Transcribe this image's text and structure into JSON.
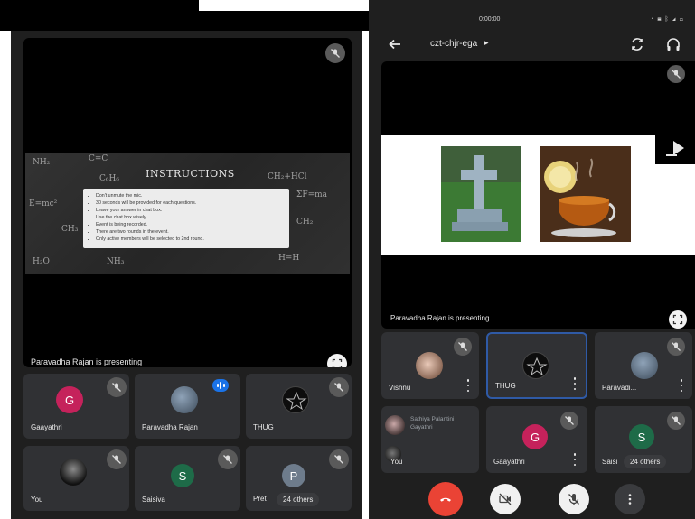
{
  "window": {
    "status_time": "0:00:00",
    "status_icons": "◔ ▦ ᛒ ◢ ▭"
  },
  "left": {
    "presentation": {
      "title": "INSTRUCTIONS",
      "instructions": [
        "Don't unmute the mic.",
        "30 seconds will be provided for each questions.",
        "Leave your answer in chat box.",
        "Use the chat box wisely.",
        "Event is being recorded.",
        "There are two rounds in the event.",
        "Only active members will be selected to 2nd round."
      ],
      "chem": [
        "NH₂",
        "C=C",
        "CH₂+HCl",
        "E=mc²",
        "CH₂",
        "C₆H₆",
        "ΣF=ma",
        "CH₃",
        "NH₃",
        "H₂O",
        "H=H"
      ],
      "presenter_label": "Paravadha Rajan is presenting"
    },
    "tiles": [
      {
        "name": "Gaayathri",
        "initial": "G",
        "color": "#c5225b"
      },
      {
        "name": "Paravadha Rajan"
      },
      {
        "name": "THUG"
      },
      {
        "name": "You"
      },
      {
        "name": "Saisiva",
        "initial": "S",
        "color": "#1e6b48"
      },
      {
        "name": "Pret",
        "initial": "P",
        "color": "#6e7c8c",
        "others": "24 others"
      }
    ]
  },
  "right": {
    "meeting_code": "czt-chjr-ega",
    "caret": "▸",
    "presenter_label": "Paravadha Rajan is presenting",
    "tiles": [
      {
        "name": "Vishnu"
      },
      {
        "name": "THUG"
      },
      {
        "name": "Paravadi..."
      },
      {
        "name": "You",
        "caption_line1": "Sathiya Palantini",
        "caption_line2": "Gayathri"
      },
      {
        "name": "Gaayathri",
        "initial": "G",
        "color": "#c5225b"
      },
      {
        "name": "Saisi",
        "initial": "S",
        "color": "#1e6b48",
        "others": "24 others"
      }
    ]
  },
  "colors": {
    "end_call": "#ea4335",
    "speaking": "#1a73e8",
    "active_border": "#2f5aa6"
  }
}
